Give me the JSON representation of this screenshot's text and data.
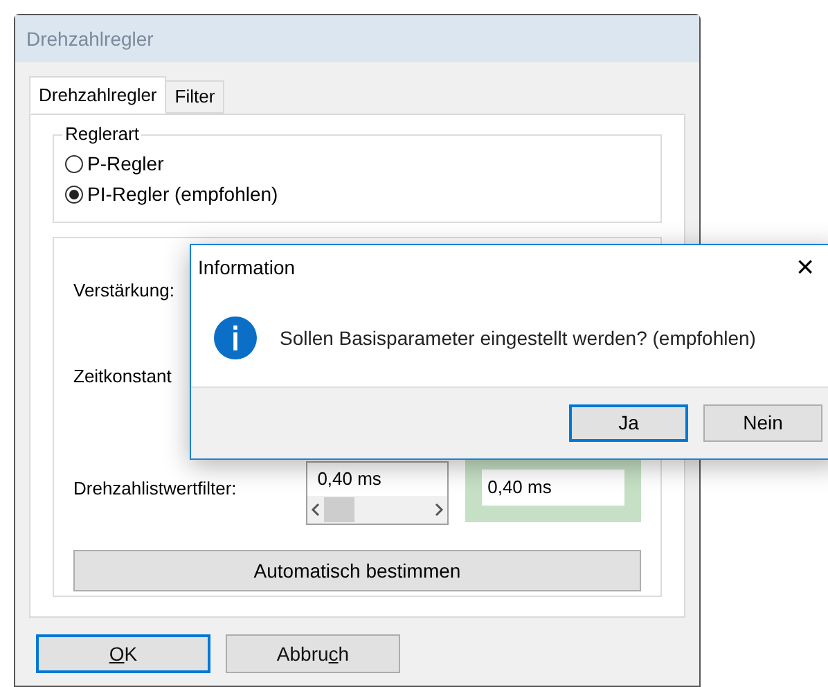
{
  "window": {
    "title": "Drehzahlregler"
  },
  "tabs": [
    {
      "label": "Drehzahlregler",
      "selected": true
    },
    {
      "label": "Filter",
      "selected": false
    }
  ],
  "controller_type": {
    "title": "Reglerart",
    "options": [
      {
        "label": "P-Regler",
        "selected": false
      },
      {
        "label": "PI-Regler (empfohlen)",
        "selected": true
      }
    ]
  },
  "parameters": {
    "labels": [
      "Verstärkung:",
      "Zeitkonstant",
      "Drehzahlistwertfilter:"
    ],
    "filter_field": {
      "value": "0,40 ms"
    },
    "filter_result": {
      "value": "0,40 ms"
    },
    "auto_button": "Automatisch bestimmen"
  },
  "buttons": [
    {
      "mnemonic": "O",
      "rest": "K",
      "focused": true
    },
    {
      "lead": "Abbru",
      "mnemonic": "c",
      "rest": "h",
      "focused": false
    }
  ],
  "message_box": {
    "title": "Information",
    "close": "×",
    "message": "Sollen Basisparameter eingestellt werden? (empfohlen)",
    "buttons": [
      {
        "label": "Ja",
        "focused": true
      },
      {
        "label": "Nein",
        "focused": false
      }
    ]
  }
}
